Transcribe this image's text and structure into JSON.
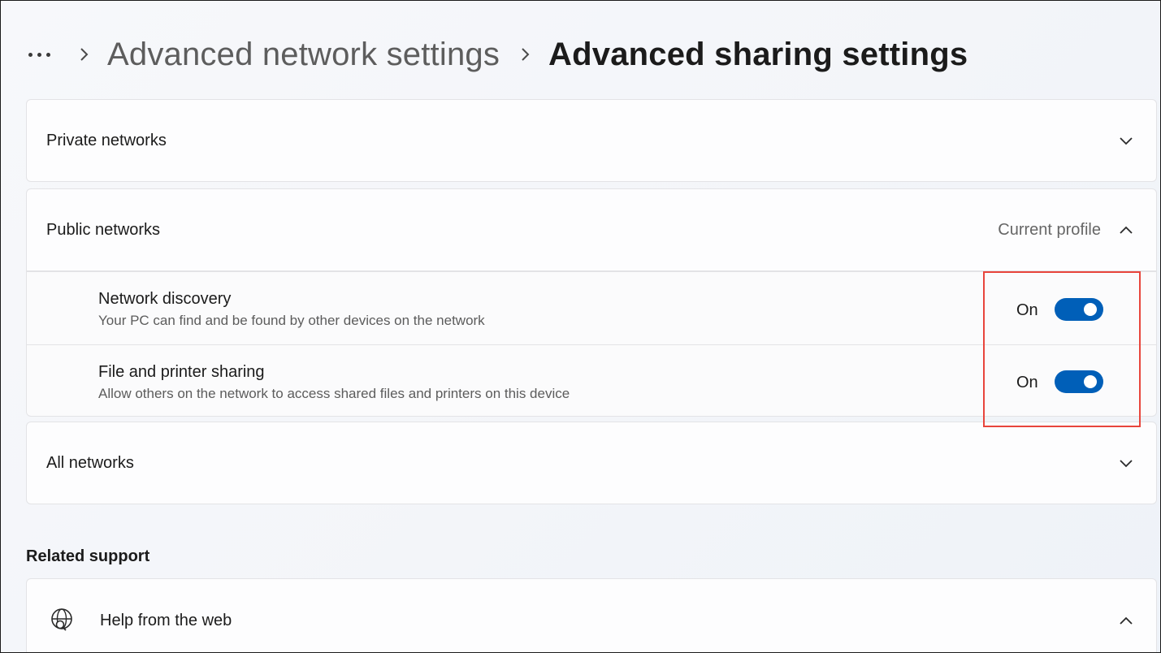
{
  "breadcrumb": {
    "more_icon": "more-dots-icon",
    "previous": "Advanced network settings",
    "current": "Advanced sharing settings",
    "separator_icon": "chevron-right-icon"
  },
  "sections": {
    "private": {
      "title": "Private networks",
      "expanded": false,
      "icon": "chevron-down-icon"
    },
    "public": {
      "title": "Public networks",
      "badge": "Current profile",
      "expanded": true,
      "icon": "chevron-up-icon",
      "settings": [
        {
          "title": "Network discovery",
          "description": "Your PC can find and be found by other devices on the network",
          "state": "On",
          "enabled": true
        },
        {
          "title": "File and printer sharing",
          "description": "Allow others on the network to access shared files and printers on this device",
          "state": "On",
          "enabled": true
        }
      ]
    },
    "all": {
      "title": "All networks",
      "expanded": false,
      "icon": "chevron-down-icon"
    }
  },
  "related_support": {
    "heading": "Related support",
    "items": [
      {
        "title": "Help from the web",
        "icon": "globe-search-icon",
        "expanded": true
      }
    ]
  },
  "colors": {
    "accent": "#005fb8",
    "highlight": "#e8453c"
  }
}
